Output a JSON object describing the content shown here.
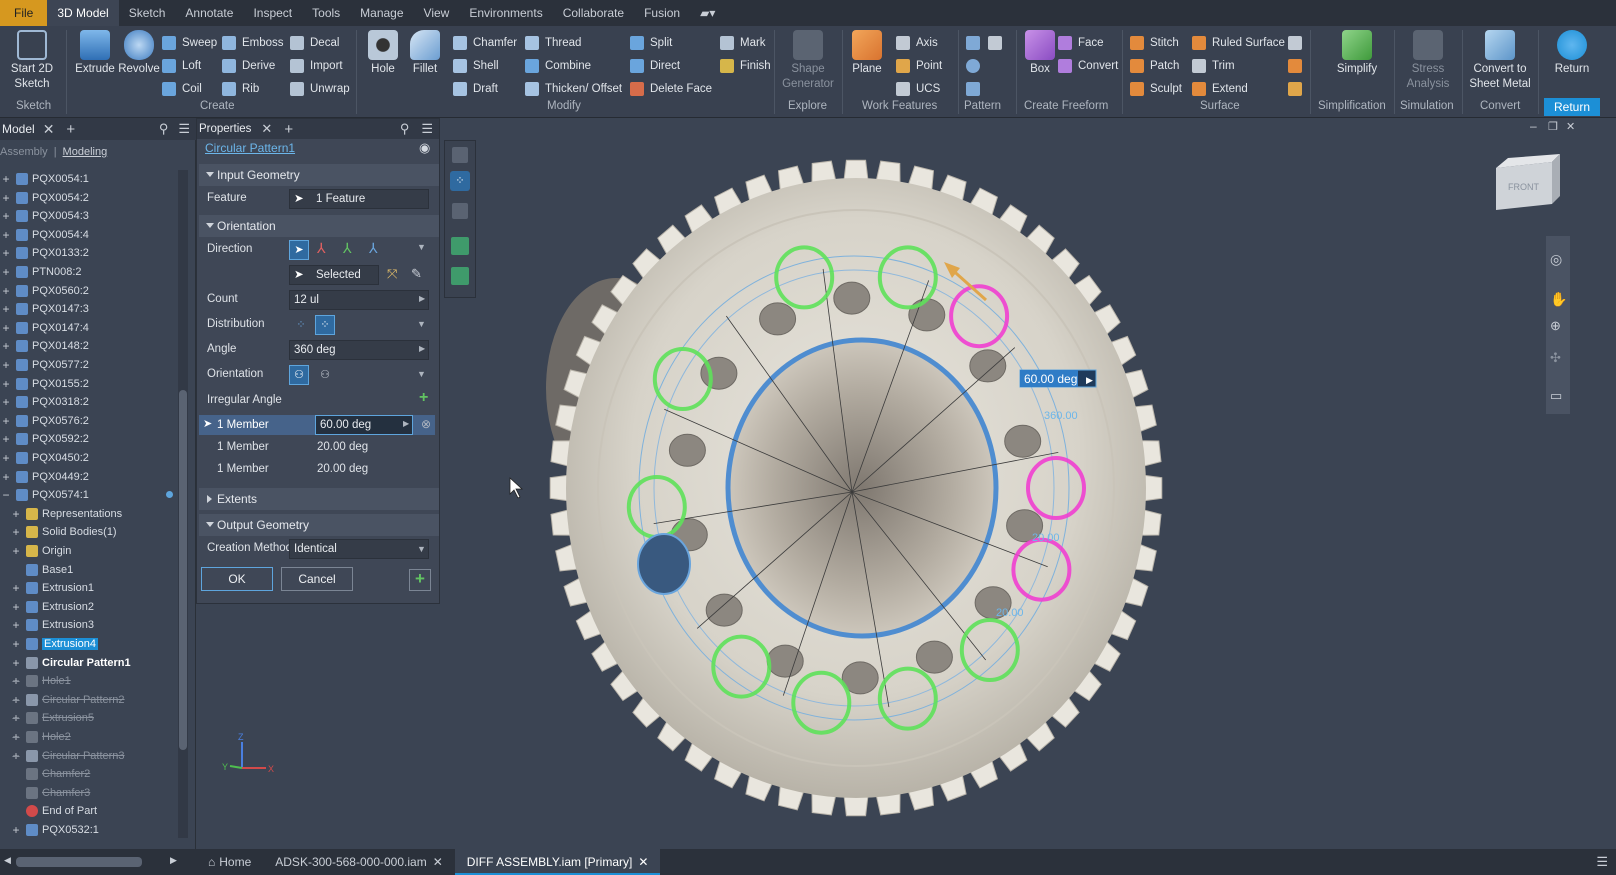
{
  "menubar": [
    "File",
    "3D Model",
    "Sketch",
    "Annotate",
    "Inspect",
    "Tools",
    "Manage",
    "View",
    "Environments",
    "Collaborate",
    "Fusion"
  ],
  "ribbon": {
    "sketch": {
      "start_sketch": "Start 2D Sketch",
      "panel": "Sketch"
    },
    "create": {
      "extrude": "Extrude",
      "revolve": "Revolve",
      "sweep": "Sweep",
      "loft": "Loft",
      "coil": "Coil",
      "emboss": "Emboss",
      "derive": "Derive",
      "rib": "Rib",
      "decal": "Decal",
      "import": "Import",
      "unwrap": "Unwrap",
      "panel": "Create"
    },
    "modify": {
      "hole": "Hole",
      "fillet": "Fillet",
      "chamfer": "Chamfer",
      "shell": "Shell",
      "draft": "Draft",
      "thread": "Thread",
      "combine": "Combine",
      "thicken": "Thicken/ Offset",
      "split": "Split",
      "direct": "Direct",
      "delete_face": "Delete Face",
      "mark": "Mark",
      "finish": "Finish",
      "panel": "Modify"
    },
    "explore": {
      "shape_generator": "Shape Generator",
      "panel": "Explore"
    },
    "work": {
      "plane": "Plane",
      "axis": "Axis",
      "point": "Point",
      "ucs": "UCS",
      "panel": "Work Features"
    },
    "pattern": {
      "panel": "Pattern"
    },
    "freeform": {
      "box": "Box",
      "face": "Face",
      "convert": "Convert",
      "panel": "Create Freeform"
    },
    "surface": {
      "stitch": "Stitch",
      "patch": "Patch",
      "sculpt": "Sculpt",
      "ruled": "Ruled Surface",
      "trim": "Trim",
      "extend": "Extend",
      "panel": "Surface"
    },
    "simplify": {
      "simplify": "Simplify",
      "panel": "Simplification"
    },
    "simulation": {
      "stress": "Stress Analysis",
      "panel": "Simulation"
    },
    "convert": {
      "sheet": "Convert to Sheet Metal",
      "panel": "Convert"
    },
    "return": {
      "label": "Return",
      "panel": "Return"
    }
  },
  "browser": {
    "tab_model": "Model",
    "assembly": "Assembly",
    "modeling": "Modeling",
    "items": [
      {
        "label": "PQX0054:1"
      },
      {
        "label": "PQX0054:2"
      },
      {
        "label": "PQX0054:3"
      },
      {
        "label": "PQX0054:4"
      },
      {
        "label": "PQX0133:2"
      },
      {
        "label": "PTN008:2"
      },
      {
        "label": "PQX0560:2"
      },
      {
        "label": "PQX0147:3"
      },
      {
        "label": "PQX0147:4"
      },
      {
        "label": "PQX0148:2"
      },
      {
        "label": "PQX0577:2"
      },
      {
        "label": "PQX0155:2"
      },
      {
        "label": "PQX0318:2"
      },
      {
        "label": "PQX0576:2"
      },
      {
        "label": "PQX0592:2"
      },
      {
        "label": "PQX0450:2"
      },
      {
        "label": "PQX0449:2"
      },
      {
        "label": "PQX0574:1"
      },
      {
        "label": "Representations"
      },
      {
        "label": "Solid Bodies(1)"
      },
      {
        "label": "Origin"
      },
      {
        "label": "Base1"
      },
      {
        "label": "Extrusion1"
      },
      {
        "label": "Extrusion2"
      },
      {
        "label": "Extrusion3"
      },
      {
        "label": "Extrusion4"
      },
      {
        "label": "Circular Pattern1"
      },
      {
        "label": "Hole1"
      },
      {
        "label": "Circular Pattern2"
      },
      {
        "label": "Extrusion5"
      },
      {
        "label": "Hole2"
      },
      {
        "label": "Circular Pattern3"
      },
      {
        "label": "Chamfer2"
      },
      {
        "label": "Chamfer3"
      },
      {
        "label": "End of Part"
      },
      {
        "label": "PQX0532:1"
      }
    ]
  },
  "props": {
    "tab": "Properties",
    "title": "Circular Pattern1",
    "input_geometry": "Input Geometry",
    "feature_label": "Feature",
    "feature_value": "1 Feature",
    "orientation_section": "Orientation",
    "direction_label": "Direction",
    "selected": "Selected",
    "count_label": "Count",
    "count_value": "12 ul",
    "distribution_label": "Distribution",
    "angle_label": "Angle",
    "angle_value": "360 deg",
    "orientation_label": "Orientation",
    "irregular_label": "Irregular Angle",
    "members": [
      {
        "label": "1 Member",
        "value": "60.00 deg"
      },
      {
        "label": "1 Member",
        "value": "20.00 deg"
      },
      {
        "label": "1 Member",
        "value": "20.00 deg"
      }
    ],
    "extents": "Extents",
    "output_geometry": "Output Geometry",
    "creation_label": "Creation Method",
    "creation_value": "Identical",
    "ok": "OK",
    "cancel": "Cancel"
  },
  "viewport": {
    "angle_input": "60.00 deg",
    "dim_360": "360.00",
    "dim_20a": "20.00",
    "dim_20b": "20.00",
    "viewcube": "FRONT",
    "axis_x": "X",
    "axis_y": "Y",
    "axis_z": "Z"
  },
  "tabs": {
    "home": "Home",
    "doc1": "ADSK-300-568-000-000.iam",
    "doc2": "DIFF ASSEMBLY.iam [Primary]"
  },
  "colors": {
    "accent": "#1c8fd6",
    "file_tab": "#d6981f",
    "green_ring": "#5ee15a",
    "pink_ring": "#f03fd0"
  }
}
